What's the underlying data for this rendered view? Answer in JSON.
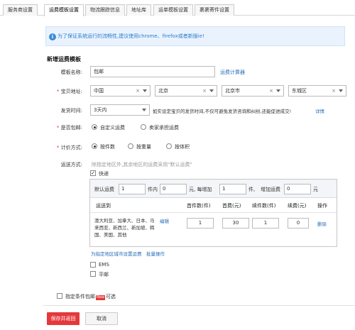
{
  "tabs": [
    "服务商设置",
    "运费模板设置",
    "物流跟踪信息",
    "地址库",
    "运单模板设置",
    "裹裹寄件设置"
  ],
  "notice": {
    "text": "为了保证系统运行的流畅性,建议使用chrome、firefox或者新版ie!"
  },
  "section_title": "新增运费模板",
  "form": {
    "name_label": "模板名称:",
    "name_value": "包邮",
    "calc_link": "运费计算器",
    "address_label": "宝贝地址:",
    "country": "中国",
    "province": "北京",
    "city": "北京市",
    "district": "东城区",
    "ship_time_label": "发货时间:",
    "ship_time": "3天内",
    "ship_time_hint": "如实设定宝贝的发货时间,不仅可避免发货咨询和纠纷,还能促进成交!",
    "details_link": "详情",
    "free_label": "是否包邮:",
    "free_opt1": "自定义运费",
    "free_opt2": "卖家承担运费",
    "pricing_label": "计价方式:",
    "pricing_opt1": "按件数",
    "pricing_opt2": "按重量",
    "pricing_opt3": "按体积",
    "method_label": "运送方式:",
    "method_hint": "除指定地区外,其余地区的运费采用\"默认运费\"",
    "express_label": "快递",
    "ems_label": "EMS",
    "mail_label": "平邮",
    "conditional_label": "指定条件包邮",
    "new_badge": "New",
    "optional": "可选"
  },
  "default_fee": {
    "label": "默认运费",
    "first_count": "1",
    "unit_pieces": "件内",
    "first_fee": "0",
    "yuan_each": "元,  每增加",
    "add_count": "1",
    "unit_piece": "件,",
    "add_fee_label": "增加运费",
    "add_fee": "0",
    "yuan": "元"
  },
  "table": {
    "headers": [
      "运送到",
      "首件数(件)",
      "首费(元)",
      "续件数(件)",
      "续费(元)",
      "操作"
    ],
    "row": {
      "destination": "澳大利亚、加拿大、日本、马来西亚、新西兰、新加坡、韩国、美国、其他",
      "edit": "编辑",
      "first_count": "1",
      "first_fee": "30",
      "add_count": "1",
      "add_fee": "0",
      "delete": "删除"
    },
    "region_link": "为指定地区城市设置运费",
    "batch_link": "批量操作"
  },
  "buttons": {
    "save": "保存并返回",
    "cancel": "取消"
  }
}
